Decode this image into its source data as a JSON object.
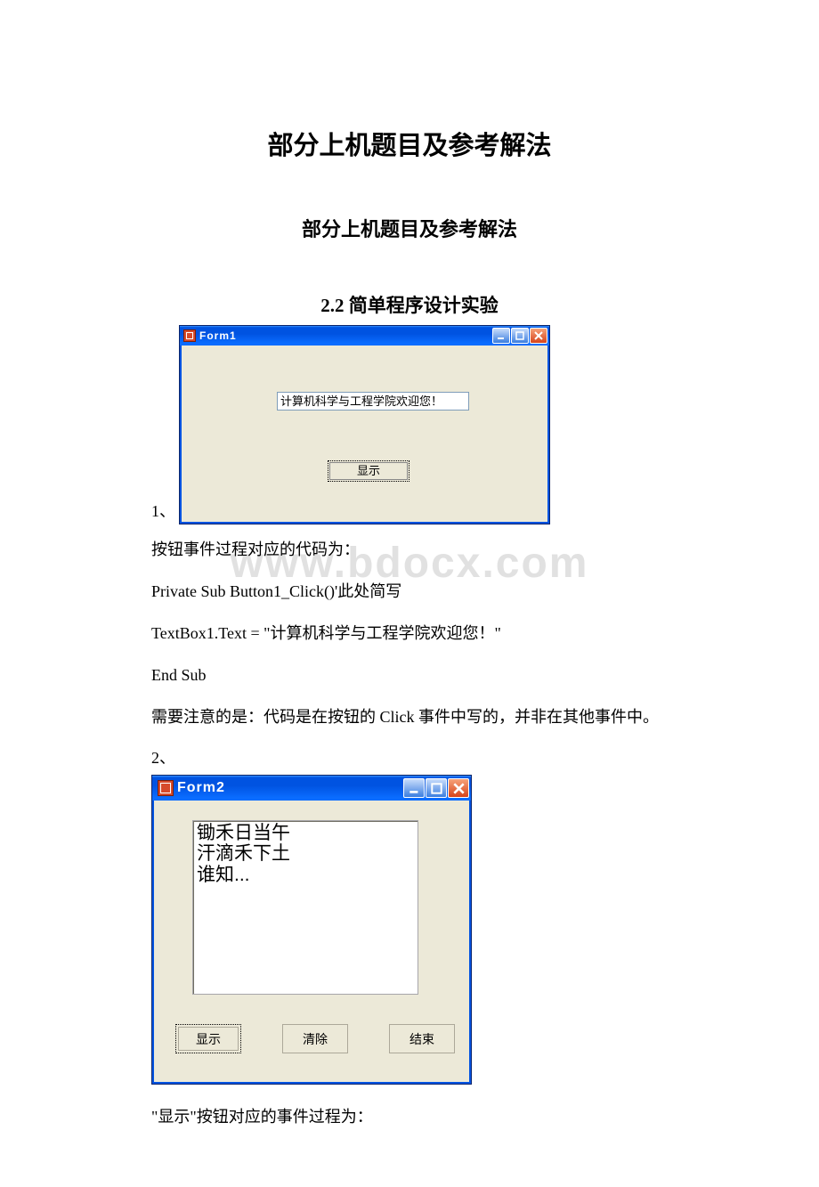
{
  "title": "部分上机题目及参考解法",
  "subtitle": "部分上机题目及参考解法",
  "section": "2.2 简单程序设计实验",
  "item1_label": "1、",
  "form1": {
    "title": "Form1",
    "textbox_value": "计算机科学与工程学院欢迎您！",
    "button_label": "显示"
  },
  "paragraphs": {
    "p1": "按钮事件过程对应的代码为：",
    "p2": " Private Sub Button1_Click()'此处简写",
    "p3": " TextBox1.Text = \"计算机科学与工程学院欢迎您！\"",
    "p4": "End Sub",
    "p5": "需要注意的是：代码是在按钮的 Click 事件中写的，并非在其他事件中。",
    "p6": "2、"
  },
  "form2": {
    "title": "Form2",
    "textarea_value": "锄禾日当午\n汗滴禾下土\n谁知...",
    "btn_show": "显示",
    "btn_clear": "清除",
    "btn_end": "结束"
  },
  "p7": "\"显示\"按钮对应的事件过程为：",
  "watermark": "www.bdocx.com"
}
